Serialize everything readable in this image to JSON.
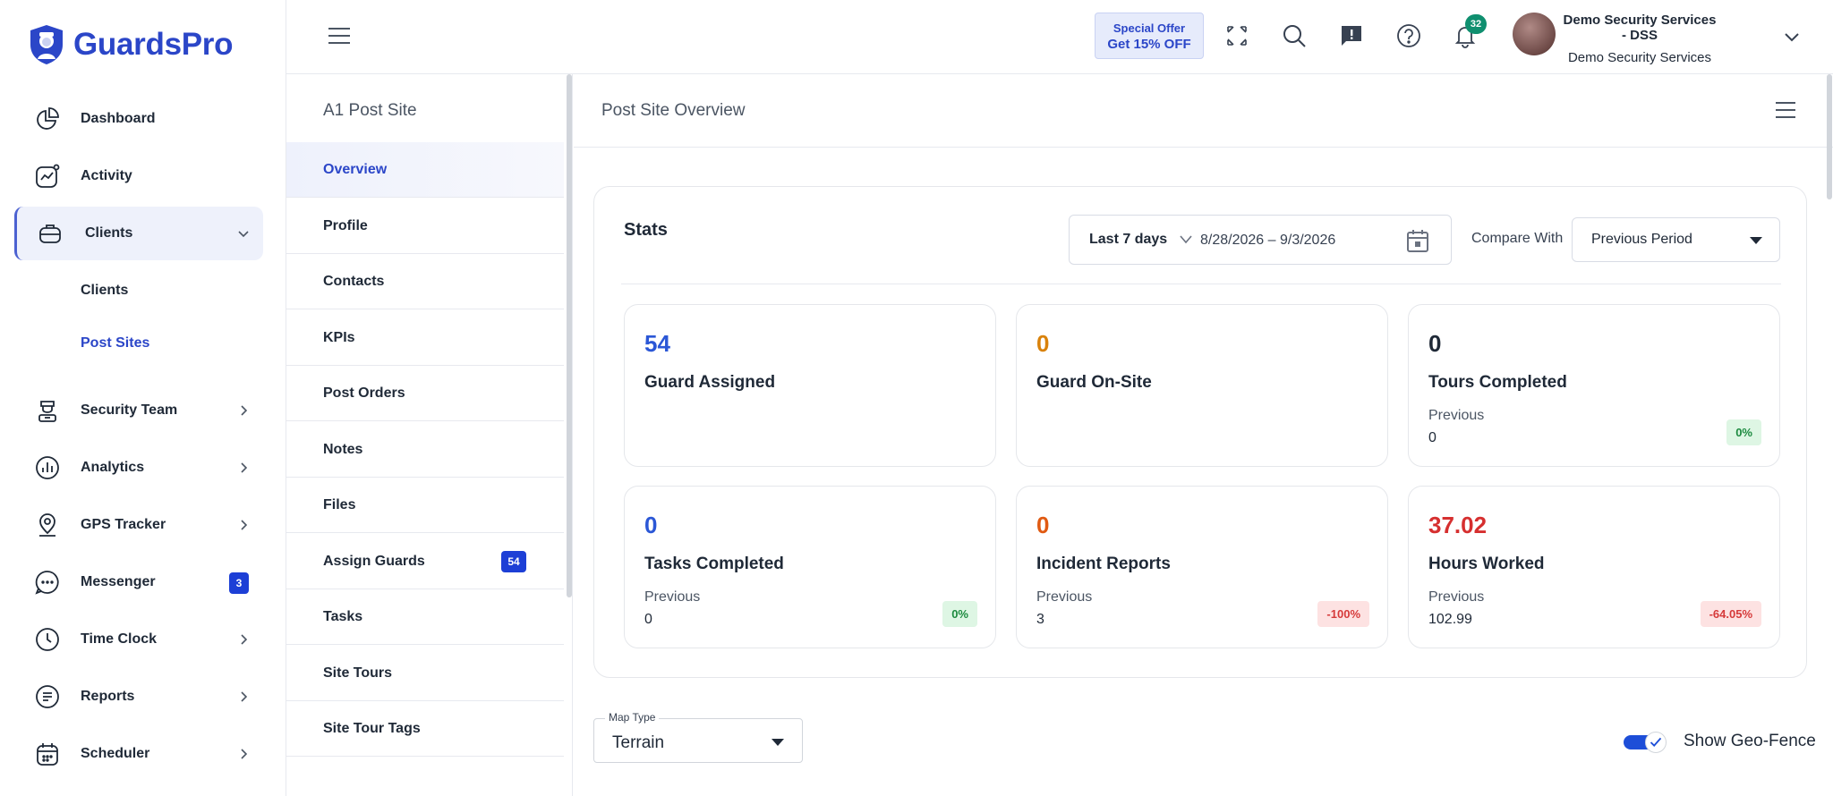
{
  "brand": {
    "name": "GuardsPro",
    "color": "#2b46c8"
  },
  "sidebar": {
    "items": [
      {
        "label": "Dashboard",
        "icon": "pie-chart-icon"
      },
      {
        "label": "Activity",
        "icon": "activity-icon"
      },
      {
        "label": "Clients",
        "icon": "briefcase-icon",
        "expanded": true
      },
      {
        "label": "Security Team",
        "icon": "guard-icon"
      },
      {
        "label": "Analytics",
        "icon": "analytics-icon"
      },
      {
        "label": "GPS Tracker",
        "icon": "location-pin-icon"
      },
      {
        "label": "Messenger",
        "icon": "chat-icon",
        "badge": "3"
      },
      {
        "label": "Time Clock",
        "icon": "clock-icon"
      },
      {
        "label": "Reports",
        "icon": "report-icon"
      },
      {
        "label": "Scheduler",
        "icon": "calendar-icon"
      }
    ],
    "clients_sub": [
      {
        "label": "Clients"
      },
      {
        "label": "Post Sites",
        "current": true
      }
    ]
  },
  "topbar": {
    "offer_line1": "Special Offer",
    "offer_line2": "Get 15% OFF",
    "notification_count": "32",
    "user_name": "Demo Security Services - DSS",
    "user_company": "Demo Security Services"
  },
  "postsite": {
    "title": "A1 Post Site",
    "items": [
      {
        "label": "Overview",
        "active": true
      },
      {
        "label": "Profile"
      },
      {
        "label": "Contacts"
      },
      {
        "label": "KPIs"
      },
      {
        "label": "Post Orders"
      },
      {
        "label": "Notes"
      },
      {
        "label": "Files"
      },
      {
        "label": "Assign Guards",
        "badge": "54"
      },
      {
        "label": "Tasks"
      },
      {
        "label": "Site Tours"
      },
      {
        "label": "Site Tour Tags"
      }
    ]
  },
  "main": {
    "title": "Post Site Overview",
    "stats": {
      "title": "Stats",
      "range_label": "Last 7 days",
      "range_dates": "8/28/2026 – 9/3/2026",
      "compare_label": "Compare With",
      "compare_value": "Previous Period",
      "cards": [
        {
          "value": "54",
          "name": "Guard Assigned",
          "color": "#2b57d6"
        },
        {
          "value": "0",
          "name": "Guard On-Site",
          "color": "#d9820b"
        },
        {
          "value": "0",
          "name": "Tours Completed",
          "color": "#1f2937",
          "previous_label": "Previous",
          "previous": "0",
          "change": "0%",
          "change_type": "positive"
        },
        {
          "value": "0",
          "name": "Tasks Completed",
          "color": "#2b57d6",
          "previous_label": "Previous",
          "previous": "0",
          "change": "0%",
          "change_type": "positive"
        },
        {
          "value": "0",
          "name": "Incident Reports",
          "color": "#e05a12",
          "previous_label": "Previous",
          "previous": "3",
          "change": "-100%",
          "change_type": "negative"
        },
        {
          "value": "37.02",
          "name": "Hours Worked",
          "color": "#d62f2f",
          "previous_label": "Previous",
          "previous": "102.99",
          "change": "-64.05%",
          "change_type": "negative"
        }
      ]
    },
    "map_type_label": "Map Type",
    "map_type_value": "Terrain",
    "geofence_label": "Show Geo-Fence",
    "geofence_on": true
  }
}
